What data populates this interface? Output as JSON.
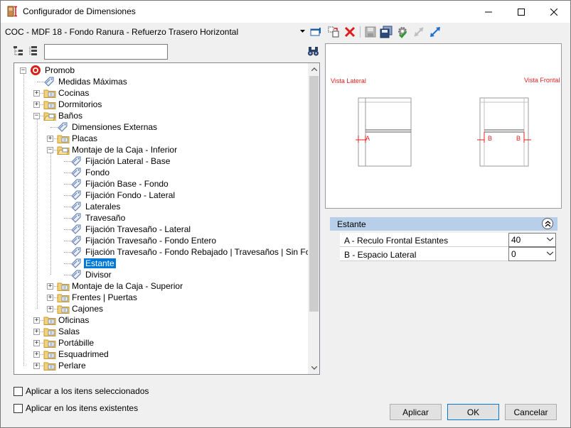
{
  "window": {
    "title": "Configurador de Dimensiones",
    "item_path": "COC - MDF 18 - Fondo Ranura - Refuerzo Trasero Horizontal"
  },
  "tree": {
    "search_value": "",
    "items": [
      {
        "label": "Promob",
        "level": 0,
        "expander": "−",
        "icon": "promob-logo-icon"
      },
      {
        "label": "Medidas Máximas",
        "level": 1,
        "expander": "",
        "icon": "tag-icon"
      },
      {
        "label": "Cocinas",
        "level": 1,
        "expander": "+",
        "icon": "folder-icon"
      },
      {
        "label": "Dormitorios",
        "level": 1,
        "expander": "+",
        "icon": "folder-icon"
      },
      {
        "label": "Baños",
        "level": 1,
        "expander": "−",
        "icon": "folder-open-icon"
      },
      {
        "label": "Dimensiones Externas",
        "level": 2,
        "expander": "",
        "icon": "tag-icon"
      },
      {
        "label": "Placas",
        "level": 2,
        "expander": "+",
        "icon": "folder-icon"
      },
      {
        "label": "Montaje de la Caja - Inferior",
        "level": 2,
        "expander": "−",
        "icon": "folder-open-icon"
      },
      {
        "label": "Fijación Lateral - Base",
        "level": 3,
        "expander": "",
        "icon": "tag-icon"
      },
      {
        "label": "Fondo",
        "level": 3,
        "expander": "",
        "icon": "tag-icon"
      },
      {
        "label": " Fijación Base - Fondo",
        "level": 3,
        "expander": "",
        "icon": "tag-icon"
      },
      {
        "label": "Fijación Fondo - Lateral",
        "level": 3,
        "expander": "",
        "icon": "tag-icon"
      },
      {
        "label": "Laterales",
        "level": 3,
        "expander": "",
        "icon": "tag-icon"
      },
      {
        "label": "Travesaño",
        "level": 3,
        "expander": "",
        "icon": "tag-icon"
      },
      {
        "label": "Fijación Travesaño - Lateral",
        "level": 3,
        "expander": "",
        "icon": "tag-icon"
      },
      {
        "label": "Fijación Travesaño - Fondo Entero",
        "level": 3,
        "expander": "",
        "icon": "tag-icon"
      },
      {
        "label": "Fijación Travesaño - Fondo Rebajado | Travesaños | Sin Fondo",
        "level": 3,
        "expander": "",
        "icon": "tag-icon"
      },
      {
        "label": "Estante",
        "level": 3,
        "expander": "",
        "icon": "tag-icon",
        "selected": true
      },
      {
        "label": "Divisor",
        "level": 3,
        "expander": "",
        "icon": "tag-icon"
      },
      {
        "label": "Montaje de la Caja - Superior",
        "level": 2,
        "expander": "+",
        "icon": "folder-icon"
      },
      {
        "label": "Frentes | Puertas",
        "level": 2,
        "expander": "+",
        "icon": "folder-icon"
      },
      {
        "label": "Cajones",
        "level": 2,
        "expander": "+",
        "icon": "folder-icon"
      },
      {
        "label": "Oficinas",
        "level": 1,
        "expander": "+",
        "icon": "folder-icon"
      },
      {
        "label": "Salas",
        "level": 1,
        "expander": "+",
        "icon": "folder-icon"
      },
      {
        "label": "Portábille",
        "level": 1,
        "expander": "+",
        "icon": "folder-icon"
      },
      {
        "label": "Esquadrimed",
        "level": 1,
        "expander": "+",
        "icon": "folder-icon"
      },
      {
        "label": "Perlare",
        "level": 1,
        "expander": "+",
        "icon": "folder-icon"
      }
    ]
  },
  "preview": {
    "left_view_label": "Vista Lateral",
    "right_view_label": "Vista Frontal",
    "dim_a": "A",
    "dim_b": "B"
  },
  "properties": {
    "group_label": "Estante",
    "rows": [
      {
        "name": "A - Reculo Frontal Estantes",
        "value": "40"
      },
      {
        "name": "B - Espacio Lateral",
        "value": "0"
      }
    ]
  },
  "options": {
    "apply_selected": "Aplicar a los itens seleccionados",
    "apply_existing": "Aplicar en los itens existentes"
  },
  "buttons": {
    "apply": "Aplicar",
    "ok": "OK",
    "cancel": "Cancelar"
  },
  "colors": {
    "selection": "#0078d7",
    "group_header": "#b8cfea",
    "dimension_red": "#e31d1d"
  }
}
